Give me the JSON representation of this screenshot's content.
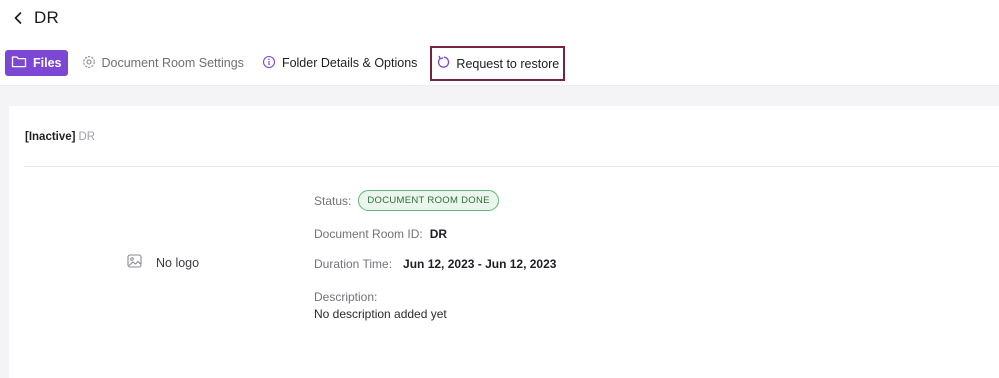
{
  "header": {
    "title": "DR"
  },
  "tabs": {
    "files": "Files",
    "settings": "Document Room Settings",
    "details": "Folder Details & Options",
    "restore": "Request to restore"
  },
  "card": {
    "inactive_tag": "[Inactive]",
    "room_name": "DR",
    "logo_text": "No logo",
    "status_label": "Status:",
    "status_value": "DOCUMENT ROOM DONE",
    "id_label": "Document Room ID:",
    "id_value": "DR",
    "duration_label": "Duration Time:",
    "duration_value": "Jun 12, 2023 - Jun 12, 2023",
    "description_label": "Description:",
    "description_value": "No description added yet"
  },
  "colors": {
    "accent": "#7b47d3",
    "highlight_border": "#7a2144",
    "status_green": "#66b27a"
  }
}
